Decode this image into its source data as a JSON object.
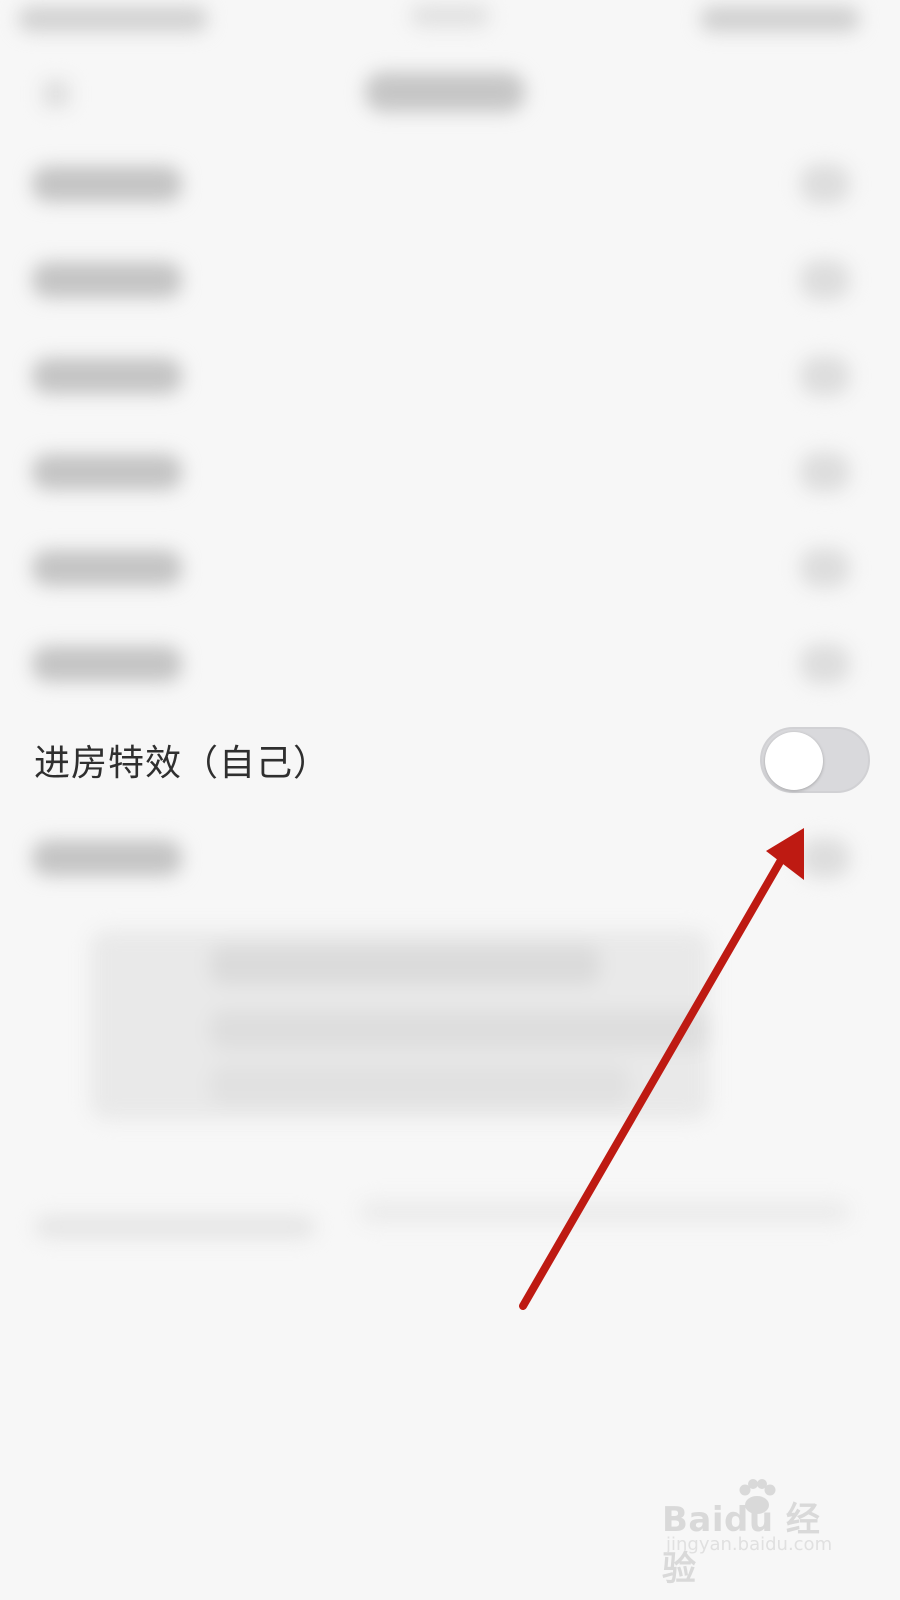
{
  "setting": {
    "label": "进房特效（自己）",
    "toggle_state": "off"
  },
  "watermark": {
    "brand": "Baidu 经验",
    "site": "jingyan.baidu.com"
  },
  "colors": {
    "toggle_track": "#d9d9dc",
    "toggle_knob": "#ffffff",
    "arrow": "#be1a12",
    "background": "#f7f7f7"
  },
  "icons": {
    "annotation": "red-arrow-icon",
    "watermark": "baidu-paw-icon"
  }
}
